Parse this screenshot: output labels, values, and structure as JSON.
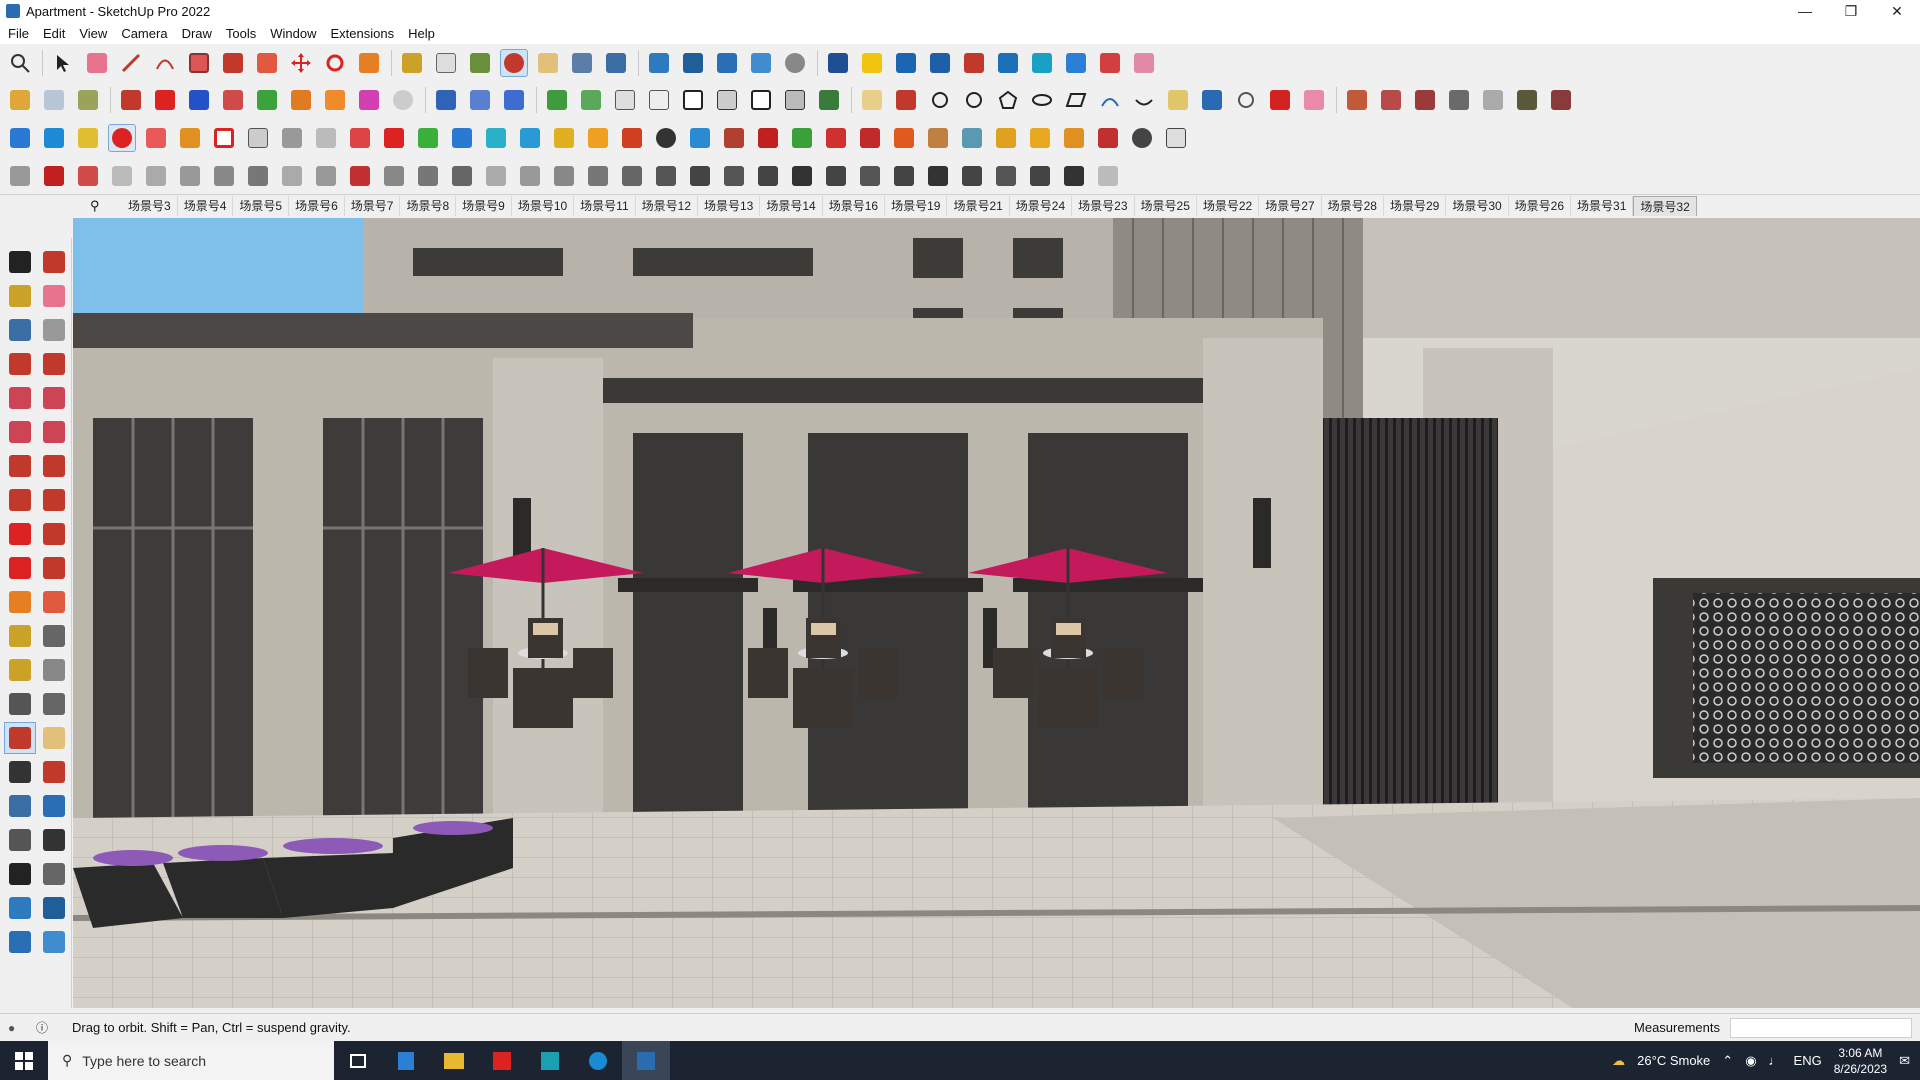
{
  "window": {
    "title": "Apartment - SketchUp Pro 2022",
    "minimize": "—",
    "maximize": "❐",
    "close": "✕"
  },
  "menu": [
    "File",
    "Edit",
    "View",
    "Camera",
    "Draw",
    "Tools",
    "Window",
    "Extensions",
    "Help"
  ],
  "scenes": {
    "tabs": [
      "场景号3",
      "场景号4",
      "场景号5",
      "场景号6",
      "场景号7",
      "场景号8",
      "场景号9",
      "场景号10",
      "场景号11",
      "场景号12",
      "场景号13",
      "场景号14",
      "场景号16",
      "场景号19",
      "场景号21",
      "场景号24",
      "场景号23",
      "场景号25",
      "场景号22",
      "场景号27",
      "场景号28",
      "场景号29",
      "场景号30",
      "场景号26",
      "场景号31",
      "场景号32"
    ],
    "active": "场景号32"
  },
  "status": {
    "hint": "Drag to orbit. Shift = Pan, Ctrl = suspend gravity.",
    "measurements_label": "Measurements",
    "measurements_value": ""
  },
  "taskbar": {
    "search_placeholder": "Type here to search",
    "weather": "26°C  Smoke",
    "language": "ENG",
    "time": "3:06 AM",
    "date": "8/26/2023"
  },
  "colors": {
    "sky": "#7fc0ea",
    "umbrella": "#c41a5b",
    "wall": "#bcb7ad",
    "floor": "#cfcac1"
  }
}
